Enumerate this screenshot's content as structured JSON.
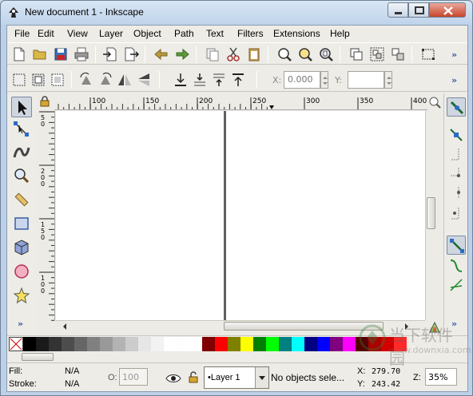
{
  "window": {
    "title": "New document 1 - Inkscape"
  },
  "menu": [
    "File",
    "Edit",
    "View",
    "Layer",
    "Object",
    "Path",
    "Text",
    "Filters",
    "Extensions",
    "Help"
  ],
  "toolbar2": {
    "x_label": "X:",
    "x_value": "0.000",
    "y_label": "Y:",
    "y_value": ""
  },
  "ruler": {
    "h_ticks": [
      "100",
      "150",
      "200",
      "250",
      "300",
      "350",
      "400"
    ],
    "v_ticks": [
      "5\n0",
      "2\n0\n0",
      "1\n5\n0",
      "1\n0\n0"
    ]
  },
  "palette_colors": [
    "#000000",
    "#1a1a1a",
    "#333333",
    "#4d4d4d",
    "#666666",
    "#808080",
    "#999999",
    "#b3b3b3",
    "#cccccc",
    "#e6e6e6",
    "#f2f2f2",
    "#ffffff",
    "#fefefe",
    "#ffffff",
    "#800000",
    "#ff0000",
    "#808000",
    "#ffff00",
    "#008000",
    "#00ff00",
    "#008080",
    "#00ffff",
    "#000080",
    "#0000ff",
    "#800080",
    "#ff00ff",
    "#550000",
    "#aa0000",
    "#d40000",
    "#ff2a2a"
  ],
  "status": {
    "fill_label": "Fill:",
    "fill_value": "N/A",
    "stroke_label": "Stroke:",
    "stroke_value": "N/A",
    "opacity_label": "O:",
    "opacity_value": "100",
    "layer": "•Layer 1",
    "message": "No objects sele...",
    "x_label": "X:",
    "x_value": "279.70",
    "y_label": "Y:",
    "y_value": "243.42",
    "zoom_label": "Z:",
    "zoom_value": "35%"
  },
  "watermark": {
    "text": "当下软件园",
    "url": "www.downxia.com"
  }
}
